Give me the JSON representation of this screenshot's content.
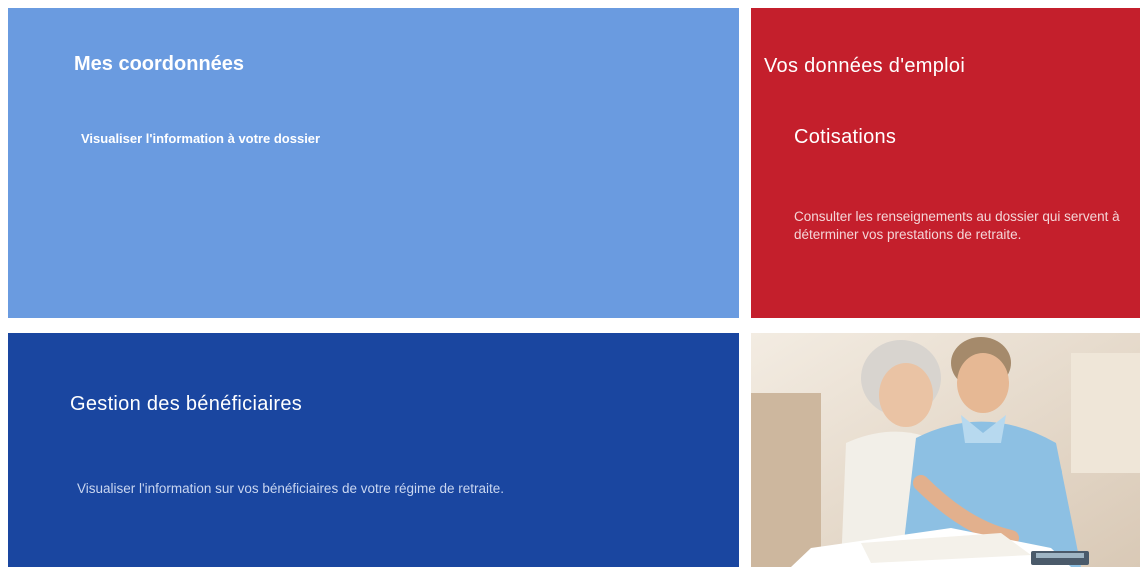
{
  "tiles": {
    "coordonnees": {
      "title": "Mes coordonnées",
      "description": "Visualiser l'information à votre dossier"
    },
    "emploi": {
      "title": "Vos données d'emploi",
      "subtitle": "Cotisations",
      "description": "Consulter les renseignements au dossier qui servent à déterminer vos prestations de retraite."
    },
    "beneficiaires": {
      "title": "Gestion des bénéficiaires",
      "description": "Visualiser l'information sur vos bénéficiaires de votre régime de retraite."
    }
  },
  "colors": {
    "light_blue": "#6a9be0",
    "red": "#c41f2c",
    "dark_blue": "#1a46a0"
  }
}
